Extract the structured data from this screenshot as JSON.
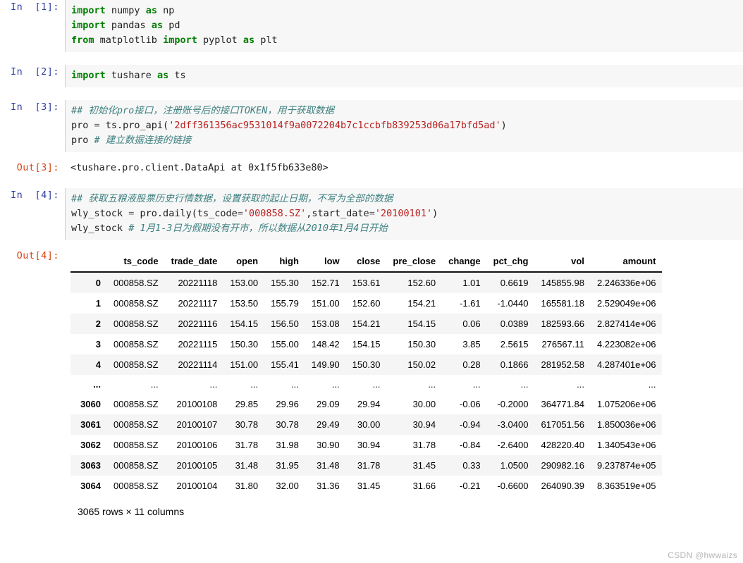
{
  "cells": [
    {
      "type": "input",
      "prompt": "In  [1]:",
      "lines": [
        [
          {
            "t": "import",
            "c": "kw"
          },
          {
            "t": " numpy ",
            "c": "plain"
          },
          {
            "t": "as",
            "c": "kw"
          },
          {
            "t": " np",
            "c": "plain"
          }
        ],
        [
          {
            "t": "import",
            "c": "kw"
          },
          {
            "t": " pandas ",
            "c": "plain"
          },
          {
            "t": "as",
            "c": "kw"
          },
          {
            "t": " pd",
            "c": "plain"
          }
        ],
        [
          {
            "t": "from",
            "c": "kw"
          },
          {
            "t": " matplotlib ",
            "c": "plain"
          },
          {
            "t": "import",
            "c": "kw"
          },
          {
            "t": " pyplot ",
            "c": "plain"
          },
          {
            "t": "as",
            "c": "kw"
          },
          {
            "t": " plt",
            "c": "plain"
          }
        ]
      ]
    },
    {
      "type": "input",
      "prompt": "In  [2]:",
      "lines": [
        [
          {
            "t": "import",
            "c": "kw"
          },
          {
            "t": " tushare ",
            "c": "plain"
          },
          {
            "t": "as",
            "c": "kw"
          },
          {
            "t": " ts",
            "c": "plain"
          }
        ]
      ]
    },
    {
      "type": "input",
      "prompt": "In  [3]:",
      "lines": [
        [
          {
            "t": "## 初始化pro接口，注册账号后的接口TOKEN，用于获取数据",
            "c": "cmt"
          }
        ],
        [
          {
            "t": "pro ",
            "c": "plain"
          },
          {
            "t": "=",
            "c": "op"
          },
          {
            "t": " ts.pro_api(",
            "c": "plain"
          },
          {
            "t": "'2dff361356ac9531014f9a0072204b7c1ccbfb839253d06a17bfd5ad'",
            "c": "str"
          },
          {
            "t": ")",
            "c": "plain"
          }
        ],
        [
          {
            "t": "pro ",
            "c": "plain"
          },
          {
            "t": "# 建立数据连接的链接",
            "c": "cmt"
          }
        ]
      ]
    },
    {
      "type": "output",
      "prompt": "Out[3]:",
      "text": "<tushare.pro.client.DataApi at 0x1f5fb633e80>"
    },
    {
      "type": "input",
      "prompt": "In  [4]:",
      "lines": [
        [
          {
            "t": "## 获取五粮液股票历史行情数据，设置获取的起止日期，不写为全部的数据",
            "c": "cmt"
          }
        ],
        [
          {
            "t": "wly_stock ",
            "c": "plain"
          },
          {
            "t": "=",
            "c": "op"
          },
          {
            "t": " pro.daily(ts_code",
            "c": "plain"
          },
          {
            "t": "=",
            "c": "op"
          },
          {
            "t": "'000858.SZ'",
            "c": "str"
          },
          {
            "t": ",start_date",
            "c": "plain"
          },
          {
            "t": "=",
            "c": "op"
          },
          {
            "t": "'20100101'",
            "c": "str"
          },
          {
            "t": ")",
            "c": "plain"
          }
        ],
        [
          {
            "t": "wly_stock ",
            "c": "plain"
          },
          {
            "t": "# 1月1-3日为假期没有开市，所以数据从2010年1月4日开始",
            "c": "cmt"
          }
        ]
      ]
    },
    {
      "type": "output-table",
      "prompt": "Out[4]:"
    }
  ],
  "dataframe": {
    "index_header": "",
    "columns": [
      "ts_code",
      "trade_date",
      "open",
      "high",
      "low",
      "close",
      "pre_close",
      "change",
      "pct_chg",
      "vol",
      "amount"
    ],
    "rows": [
      {
        "index": "0",
        "cells": [
          "000858.SZ",
          "20221118",
          "153.00",
          "155.30",
          "152.71",
          "153.61",
          "152.60",
          "1.01",
          "0.6619",
          "145855.98",
          "2.246336e+06"
        ]
      },
      {
        "index": "1",
        "cells": [
          "000858.SZ",
          "20221117",
          "153.50",
          "155.79",
          "151.00",
          "152.60",
          "154.21",
          "-1.61",
          "-1.0440",
          "165581.18",
          "2.529049e+06"
        ]
      },
      {
        "index": "2",
        "cells": [
          "000858.SZ",
          "20221116",
          "154.15",
          "156.50",
          "153.08",
          "154.21",
          "154.15",
          "0.06",
          "0.0389",
          "182593.66",
          "2.827414e+06"
        ]
      },
      {
        "index": "3",
        "cells": [
          "000858.SZ",
          "20221115",
          "150.30",
          "155.00",
          "148.42",
          "154.15",
          "150.30",
          "3.85",
          "2.5615",
          "276567.11",
          "4.223082e+06"
        ]
      },
      {
        "index": "4",
        "cells": [
          "000858.SZ",
          "20221114",
          "151.00",
          "155.41",
          "149.90",
          "150.30",
          "150.02",
          "0.28",
          "0.1866",
          "281952.58",
          "4.287401e+06"
        ]
      },
      {
        "index": "...",
        "ellipsis": true,
        "cells": [
          "...",
          "...",
          "...",
          "...",
          "...",
          "...",
          "...",
          "...",
          "...",
          "...",
          "..."
        ]
      },
      {
        "index": "3060",
        "cells": [
          "000858.SZ",
          "20100108",
          "29.85",
          "29.96",
          "29.09",
          "29.94",
          "30.00",
          "-0.06",
          "-0.2000",
          "364771.84",
          "1.075206e+06"
        ]
      },
      {
        "index": "3061",
        "cells": [
          "000858.SZ",
          "20100107",
          "30.78",
          "30.78",
          "29.49",
          "30.00",
          "30.94",
          "-0.94",
          "-3.0400",
          "617051.56",
          "1.850036e+06"
        ]
      },
      {
        "index": "3062",
        "cells": [
          "000858.SZ",
          "20100106",
          "31.78",
          "31.98",
          "30.90",
          "30.94",
          "31.78",
          "-0.84",
          "-2.6400",
          "428220.40",
          "1.340543e+06"
        ]
      },
      {
        "index": "3063",
        "cells": [
          "000858.SZ",
          "20100105",
          "31.48",
          "31.95",
          "31.48",
          "31.78",
          "31.45",
          "0.33",
          "1.0500",
          "290982.16",
          "9.237874e+05"
        ]
      },
      {
        "index": "3064",
        "cells": [
          "000858.SZ",
          "20100104",
          "31.80",
          "32.00",
          "31.36",
          "31.45",
          "31.66",
          "-0.21",
          "-0.6600",
          "264090.39",
          "8.363519e+05"
        ]
      }
    ],
    "footer": "3065 rows × 11 columns"
  },
  "watermark": "CSDN @hwwaizs",
  "colors": {
    "prompt_in": "#303f9f",
    "prompt_out": "#d84315",
    "keyword": "#008000",
    "string": "#ba2121",
    "comment": "#408080",
    "cell_bg": "#f7f7f7",
    "row_stripe": "#f5f5f5"
  }
}
